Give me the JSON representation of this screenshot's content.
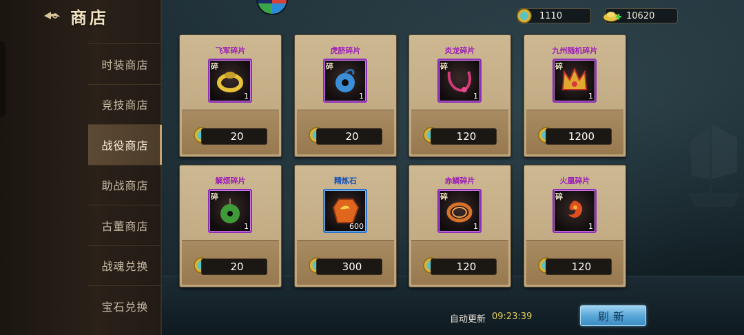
{
  "header": {
    "title": "商店"
  },
  "resources": {
    "coins": "1110",
    "ingots": "10620"
  },
  "menu": [
    {
      "label": "时装商店",
      "active": false
    },
    {
      "label": "竞技商店",
      "active": false
    },
    {
      "label": "战役商店",
      "active": true
    },
    {
      "label": "助战商店",
      "active": false
    },
    {
      "label": "古董商店",
      "active": false
    },
    {
      "label": "战魂兑换",
      "active": false
    },
    {
      "label": "宝石兑换",
      "active": false
    }
  ],
  "items": [
    {
      "name": "飞军碎片",
      "qty": "1",
      "price": "20",
      "fragment_mark": "碎",
      "icon": "gold-ring-icon"
    },
    {
      "name": "虎脐碎片",
      "qty": "1",
      "price": "20",
      "fragment_mark": "碎",
      "icon": "jade-pendant-icon"
    },
    {
      "name": "炎龙碎片",
      "qty": "1",
      "price": "120",
      "fragment_mark": "碎",
      "icon": "dragon-necklace-icon"
    },
    {
      "name": "九州随机碎片",
      "qty": "1",
      "price": "1200",
      "fragment_mark": "碎",
      "icon": "golden-crown-icon"
    },
    {
      "name": "解烦碎片",
      "qty": "1",
      "price": "20",
      "fragment_mark": "碎",
      "icon": "green-jade-icon"
    },
    {
      "name": "精炼石",
      "qty": "600",
      "price": "300",
      "fragment_mark": "",
      "icon": "refining-stone-icon"
    },
    {
      "name": "赤鳞碎片",
      "qty": "1",
      "price": "120",
      "fragment_mark": "碎",
      "icon": "red-bracelet-icon"
    },
    {
      "name": "火凰碎片",
      "qty": "1",
      "price": "120",
      "fragment_mark": "碎",
      "icon": "fire-phoenix-icon"
    }
  ],
  "footer": {
    "auto_refresh_label": "自动更新",
    "auto_refresh_time": "09:23:39",
    "refresh_button": "刷新"
  },
  "colors": {
    "item_name_purple": "#9d1cb8",
    "item_name_blue": "#1552b8",
    "refresh_time": "#e6d25a",
    "refresh_button": "#5aa7d8"
  }
}
